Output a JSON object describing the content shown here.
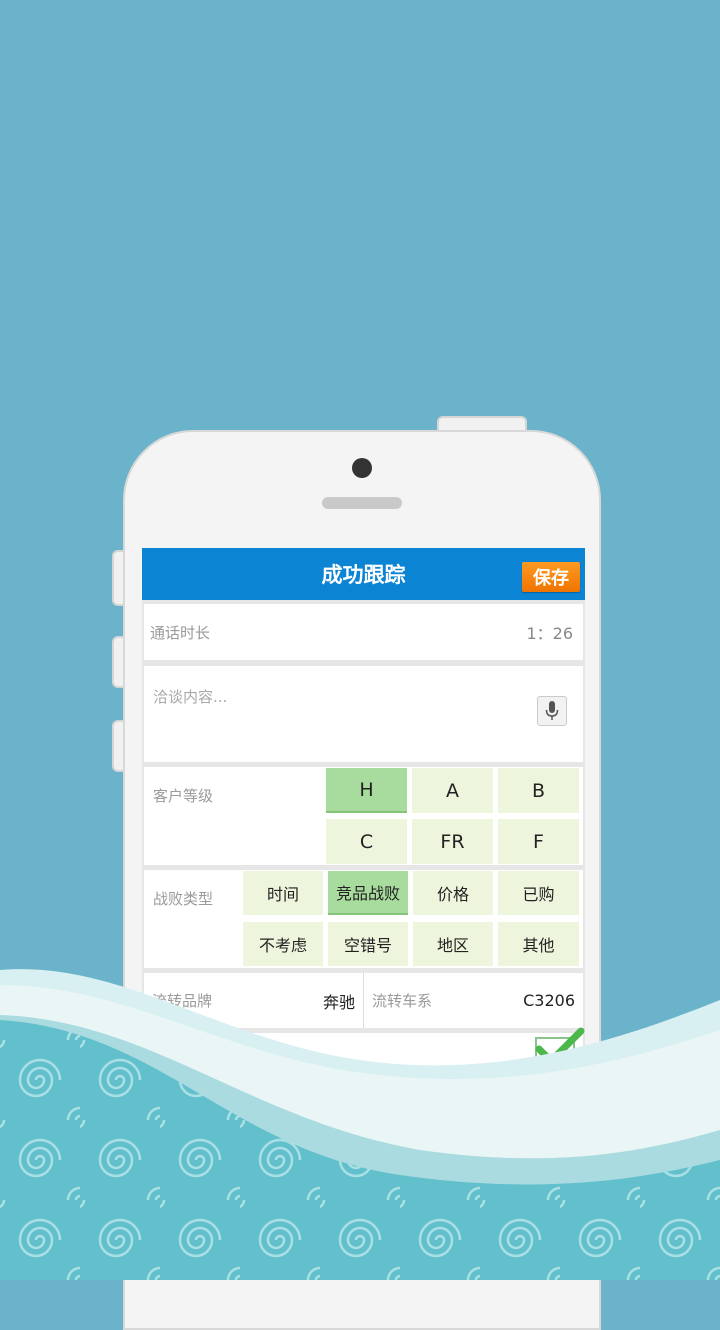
{
  "header": {
    "title": "成功跟踪",
    "save_label": "保存"
  },
  "call": {
    "label": "通话时长",
    "duration": "1：26"
  },
  "notes": {
    "placeholder": "洽谈内容..."
  },
  "customer_grade": {
    "label": "客户等级",
    "options": [
      "H",
      "A",
      "B",
      "C",
      "FR",
      "F"
    ],
    "selected": "H"
  },
  "loss_type": {
    "label": "战败类型",
    "options": [
      "时间",
      "竞品战败",
      "价格",
      "已购",
      "不考虑",
      "空错号",
      "地区",
      "其他"
    ],
    "selected": "竞品战败"
  },
  "transfer": {
    "brand_label": "流转品牌",
    "brand_value": "奔驰",
    "series_label": "流转车系",
    "series_value": "C3206"
  },
  "colors": {
    "title_bar": "#0a84d3",
    "save_button": "#f28a10",
    "selected_option": "#a8dc9e",
    "option": "#eef5dd",
    "background": "#6bb3ca"
  },
  "icons": {
    "mic": "microphone-icon",
    "check": "checkmark-icon"
  }
}
